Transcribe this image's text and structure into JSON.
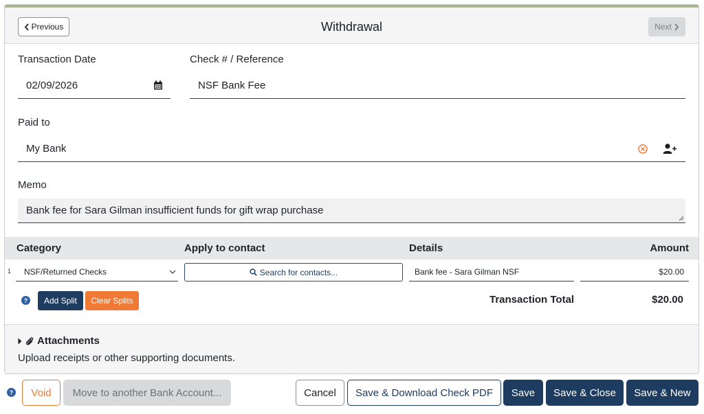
{
  "header": {
    "title": "Withdrawal",
    "previous_label": "Previous",
    "next_label": "Next"
  },
  "form": {
    "transaction_date_label": "Transaction Date",
    "transaction_date_value": "02/09/2026",
    "reference_label": "Check # / Reference",
    "reference_value": "NSF Bank Fee",
    "paid_to_label": "Paid to",
    "paid_to_value": "My Bank",
    "memo_label": "Memo",
    "memo_value": "Bank fee for Sara Gilman insufficient funds for gift wrap purchase"
  },
  "splits": {
    "columns": [
      "Category",
      "Apply to contact",
      "Details",
      "Amount"
    ],
    "rows": [
      {
        "number": "1",
        "category": "NSF/Returned Checks",
        "contact_placeholder": "Search for contacts...",
        "details": "Bank fee - Sara Gilman NSF",
        "amount": "$20.00"
      }
    ],
    "help_glyph": "?",
    "add_split_label": "Add Split",
    "clear_splits_label": "Clear Splits",
    "total_label": "Transaction Total",
    "total_value": "$20.00"
  },
  "attachments": {
    "title": "Attachments",
    "description": "Upload receipts or other supporting documents."
  },
  "footer": {
    "help_glyph": "?",
    "void_label": "Void",
    "move_label": "Move to another Bank Account...",
    "cancel_label": "Cancel",
    "save_pdf_label": "Save & Download Check PDF",
    "save_label": "Save",
    "save_close_label": "Save & Close",
    "save_new_label": "Save & New"
  },
  "colors": {
    "primary": "#1d3c60",
    "accent_orange": "#ee7a36",
    "top_accent": "#a8b58f"
  },
  "icons": [
    "chevron-left-icon",
    "chevron-right-icon",
    "calendar-icon",
    "clear-circle-icon",
    "add-person-icon",
    "chevron-down-icon",
    "search-icon",
    "help-icon",
    "caret-right-icon",
    "paperclip-icon"
  ]
}
